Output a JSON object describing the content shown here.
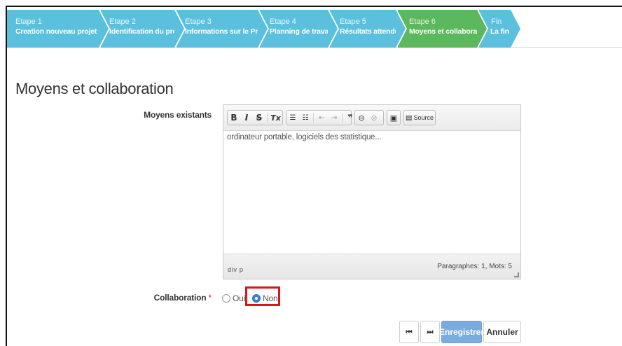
{
  "wizard": {
    "steps": [
      {
        "num": "Etape 1",
        "title": "Creation nouveau projet"
      },
      {
        "num": "Etape 2",
        "title": "Identification du projet"
      },
      {
        "num": "Etape 3",
        "title": "Informations sur le Projet"
      },
      {
        "num": "Etape 4",
        "title": "Planning de travail"
      },
      {
        "num": "Etape 5",
        "title": "Résultats attendus"
      },
      {
        "num": "Etape 6",
        "title": "Moyens et collaboration"
      },
      {
        "num": "Fin",
        "title": "La fin"
      }
    ],
    "active_index": 5,
    "colors": {
      "step": "#5bc0de",
      "active": "#5cb85c"
    }
  },
  "page": {
    "title": "Moyens et collaboration"
  },
  "form": {
    "moyens_label": "Moyens existants",
    "editor": {
      "toolbar": {
        "bold": "B",
        "italic": "I",
        "strike": "S",
        "remove_format": "Tx",
        "source": "Source"
      },
      "content": "ordinateur portable, logiciels des statistique...",
      "path": "div  p",
      "word_count": "Paragraphes: 1, Mots: 5"
    },
    "collaboration_label": "Collaboration",
    "required_mark": "*",
    "options": [
      {
        "label": "Oui",
        "checked": false
      },
      {
        "label": "Non",
        "checked": true
      }
    ]
  },
  "actions": {
    "first": "⏮",
    "last": "⏭",
    "save": "Enregistrer",
    "cancel": "Annuler"
  },
  "colors": {
    "primary_button": "#7bace0",
    "highlight": "#d9161d",
    "required": "#c9302c"
  }
}
